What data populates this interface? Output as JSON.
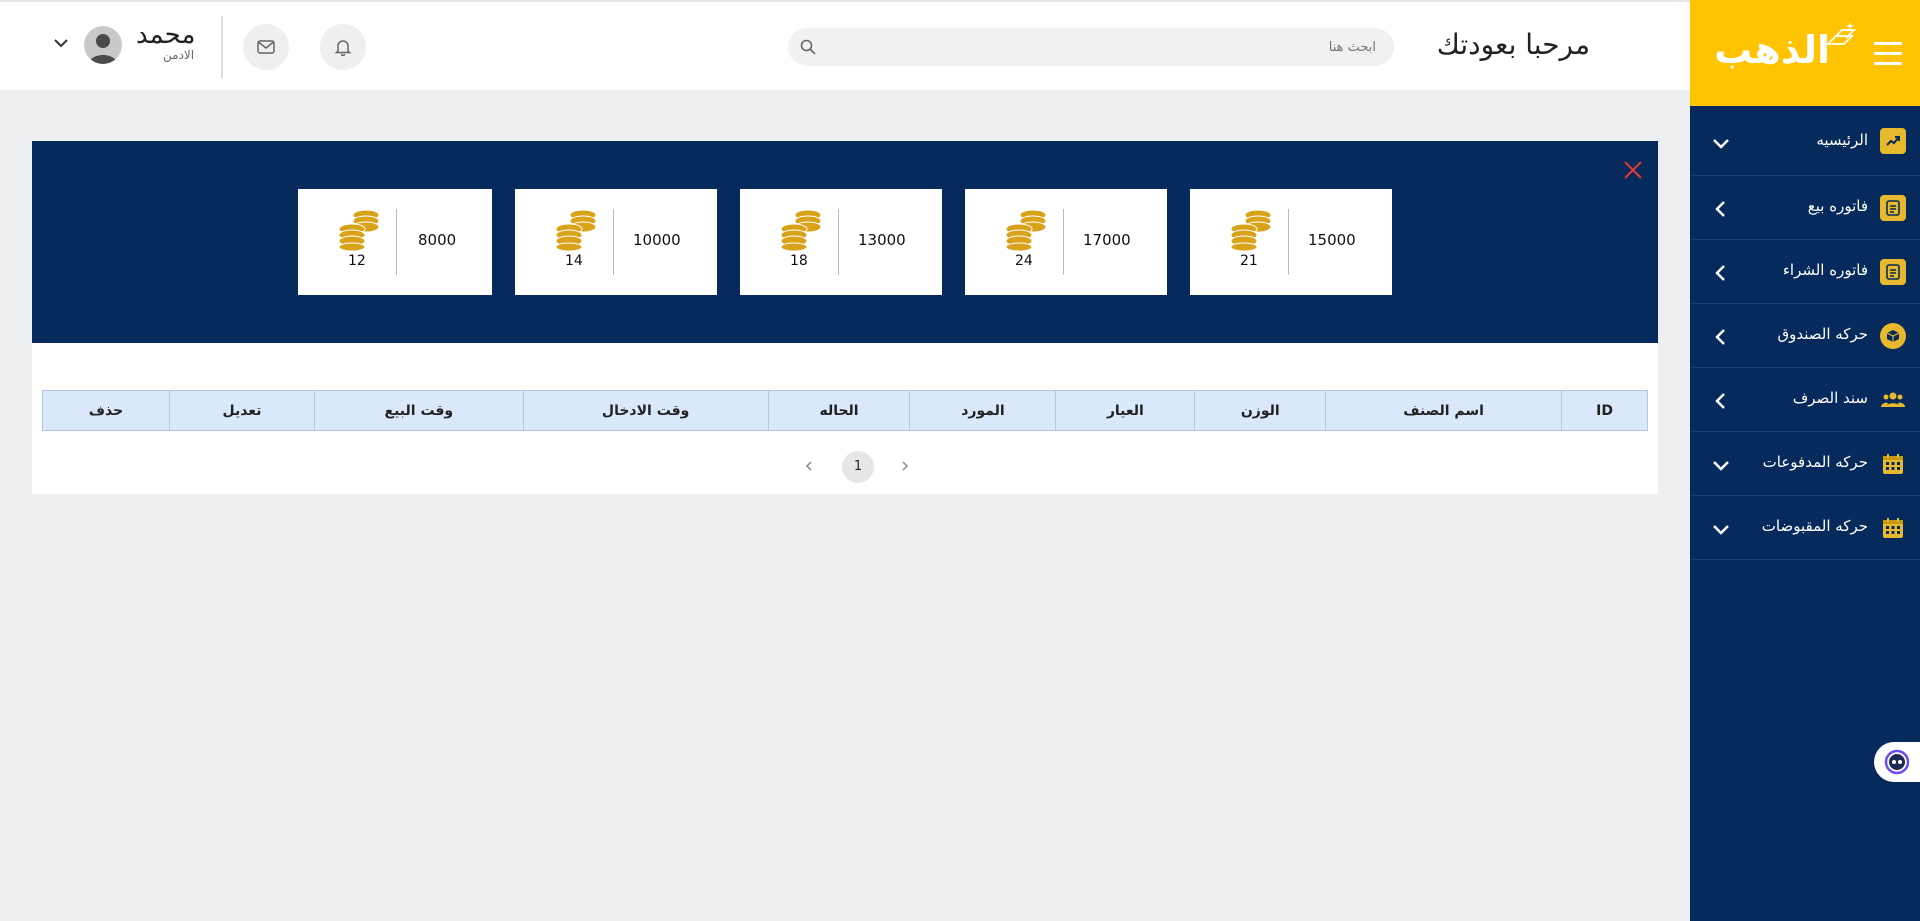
{
  "sidebar": {
    "brand_title": "الذهب",
    "items": [
      {
        "label": "الرئيسيه",
        "icon": "trending-up-icon",
        "expand": "down"
      },
      {
        "label": "فاتوره بيع",
        "icon": "document-icon",
        "expand": "left"
      },
      {
        "label": "فاتوره الشراء",
        "icon": "document-icon",
        "expand": "left"
      },
      {
        "label": "حركه الصندوق",
        "icon": "cube-icon",
        "expand": "left"
      },
      {
        "label": "سند الصرف",
        "icon": "users-icon",
        "expand": "left"
      },
      {
        "label": "حركه المدفوعات",
        "icon": "calendar-icon",
        "expand": "down"
      },
      {
        "label": "حركه المقبوضات",
        "icon": "calendar-icon",
        "expand": "down"
      }
    ]
  },
  "header": {
    "welcome": "مرحبا بعودتك",
    "search_placeholder": "ابحث هنا",
    "user_name": "محمد",
    "user_role": "الادمن"
  },
  "stats": [
    {
      "amount": "15000",
      "karat": "21"
    },
    {
      "amount": "17000",
      "karat": "24"
    },
    {
      "amount": "13000",
      "karat": "18"
    },
    {
      "amount": "10000",
      "karat": "14"
    },
    {
      "amount": "8000",
      "karat": "12"
    }
  ],
  "table": {
    "headers": [
      "ID",
      "اسم الصنف",
      "الوزن",
      "العيار",
      "المورد",
      "الحاله",
      "وقت الادخال",
      "وقت البيع",
      "تعديل",
      "حذف"
    ]
  },
  "pagination": {
    "current_page": "1"
  },
  "colors": {
    "sidebar": "#062a5c",
    "brand": "#ffc301",
    "accent_gold": "#e7b92c",
    "close": "#e03b2f",
    "table_header": "#d9e8fb"
  }
}
